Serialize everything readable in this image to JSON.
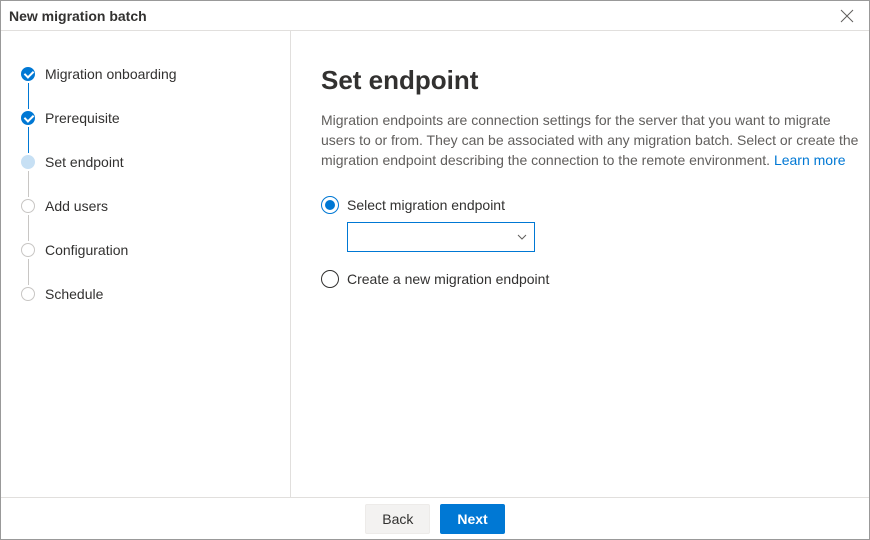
{
  "window": {
    "title": "New migration batch"
  },
  "sidebar": {
    "steps": [
      {
        "label": "Migration onboarding",
        "state": "done"
      },
      {
        "label": "Prerequisite",
        "state": "done"
      },
      {
        "label": "Set endpoint",
        "state": "current"
      },
      {
        "label": "Add users",
        "state": "future"
      },
      {
        "label": "Configuration",
        "state": "future"
      },
      {
        "label": "Schedule",
        "state": "future"
      }
    ]
  },
  "main": {
    "title": "Set endpoint",
    "description_prefix": "Migration endpoints are connection settings for the server that you want to migrate users to or from. They can be associated with any migration batch. Select or create the migration endpoint describing the connection to the remote environment. ",
    "learn_more": "Learn more",
    "options": {
      "select_label": "Select migration endpoint",
      "create_label": "Create a new migration endpoint",
      "dropdown_value": ""
    }
  },
  "footer": {
    "back": "Back",
    "next": "Next"
  }
}
